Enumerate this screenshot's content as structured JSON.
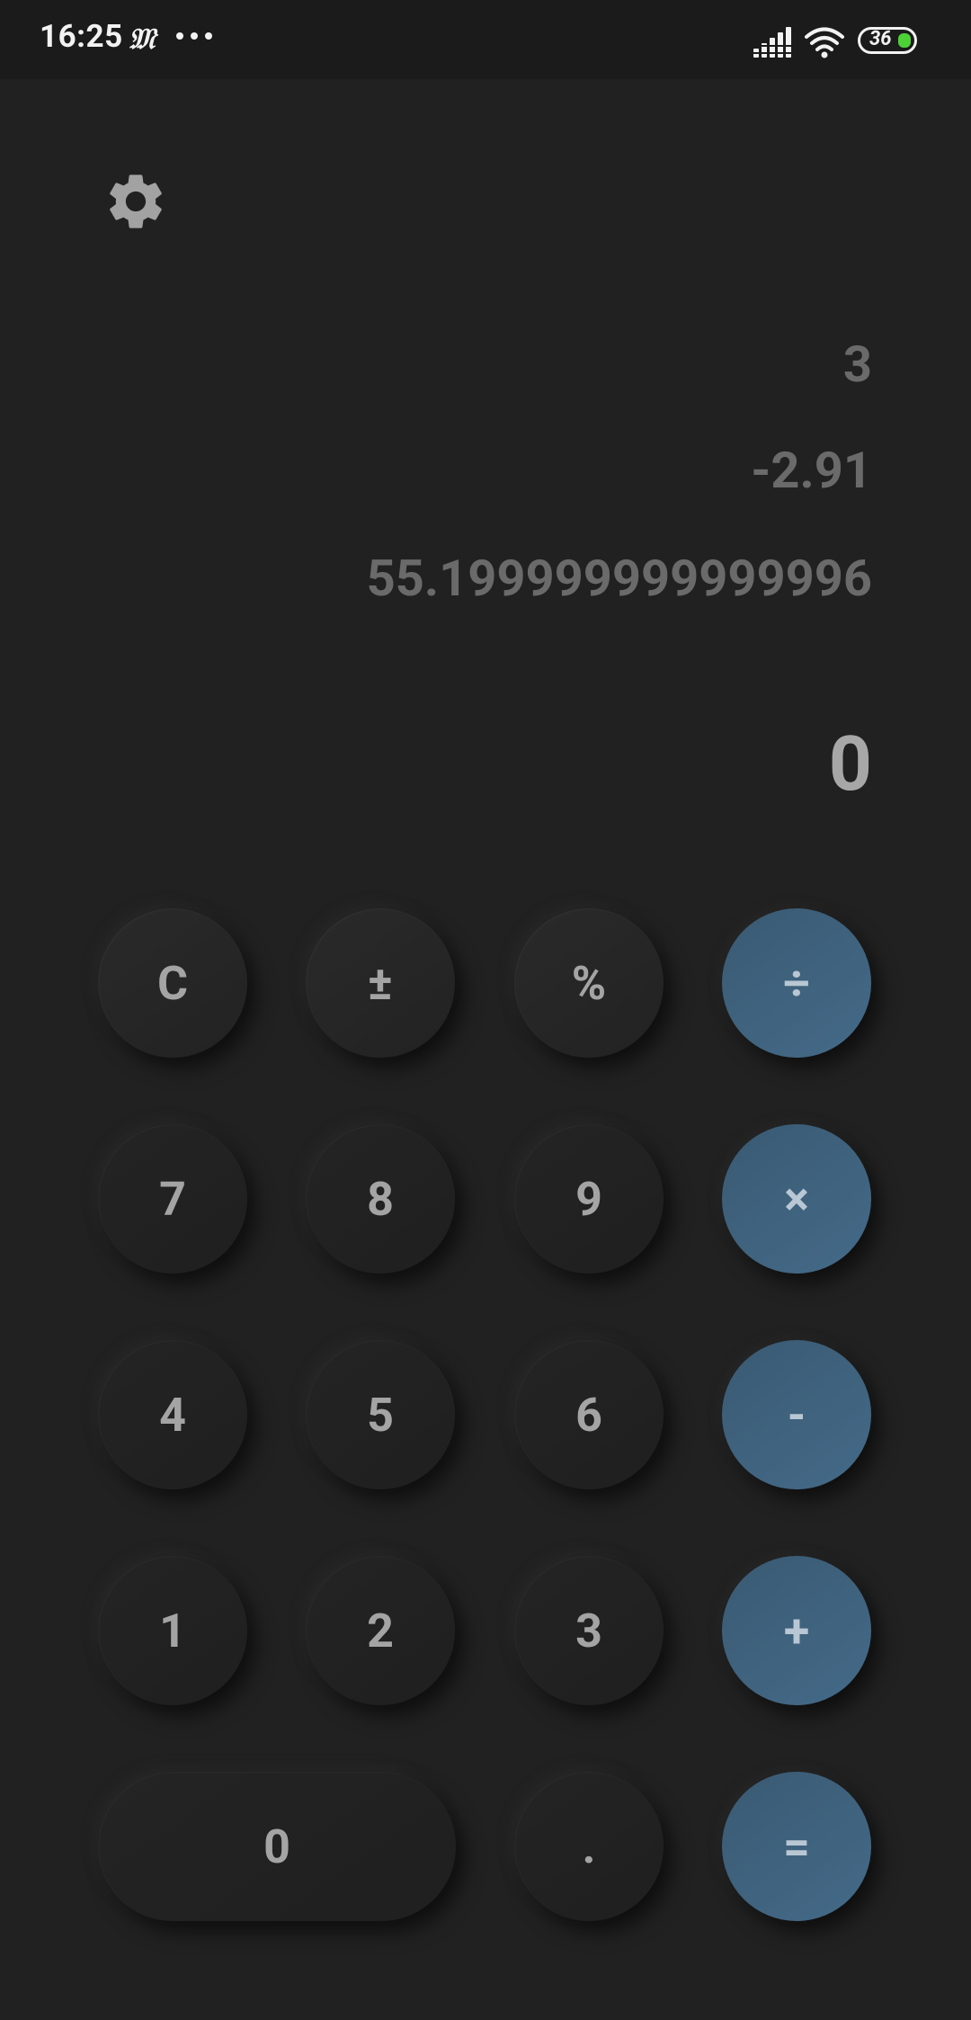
{
  "status_bar": {
    "time": "16:25",
    "carrier_glyph": "𝔐",
    "battery_level": "36",
    "icons": [
      "more-dots-icon",
      "signal-icon",
      "wifi-icon",
      "battery-icon"
    ]
  },
  "settings": {
    "icon": "gear-icon"
  },
  "display": {
    "history": [
      "3",
      "-2.91",
      "55.199999999999996"
    ],
    "current": "0"
  },
  "keypad": {
    "rows": [
      [
        {
          "label": "C",
          "type": "func"
        },
        {
          "label": "±",
          "type": "func"
        },
        {
          "label": "%",
          "type": "func"
        },
        {
          "label": "÷",
          "type": "op"
        }
      ],
      [
        {
          "label": "7",
          "type": "num"
        },
        {
          "label": "8",
          "type": "num"
        },
        {
          "label": "9",
          "type": "num"
        },
        {
          "label": "×",
          "type": "op"
        }
      ],
      [
        {
          "label": "4",
          "type": "num"
        },
        {
          "label": "5",
          "type": "num"
        },
        {
          "label": "6",
          "type": "num"
        },
        {
          "label": "-",
          "type": "op"
        }
      ],
      [
        {
          "label": "1",
          "type": "num"
        },
        {
          "label": "2",
          "type": "num"
        },
        {
          "label": "3",
          "type": "num"
        },
        {
          "label": "+",
          "type": "op"
        }
      ],
      [
        {
          "label": "0",
          "type": "num"
        },
        {
          "label": ".",
          "type": "num"
        },
        {
          "label": "=",
          "type": "op"
        }
      ]
    ]
  },
  "colors": {
    "background": "#212121",
    "status_bar": "#1b1b1b",
    "operator_key": "#3f6480",
    "digit_text": "#a4a4a4",
    "history_text": "#6a6a6a",
    "battery_fill": "#4cd137"
  }
}
